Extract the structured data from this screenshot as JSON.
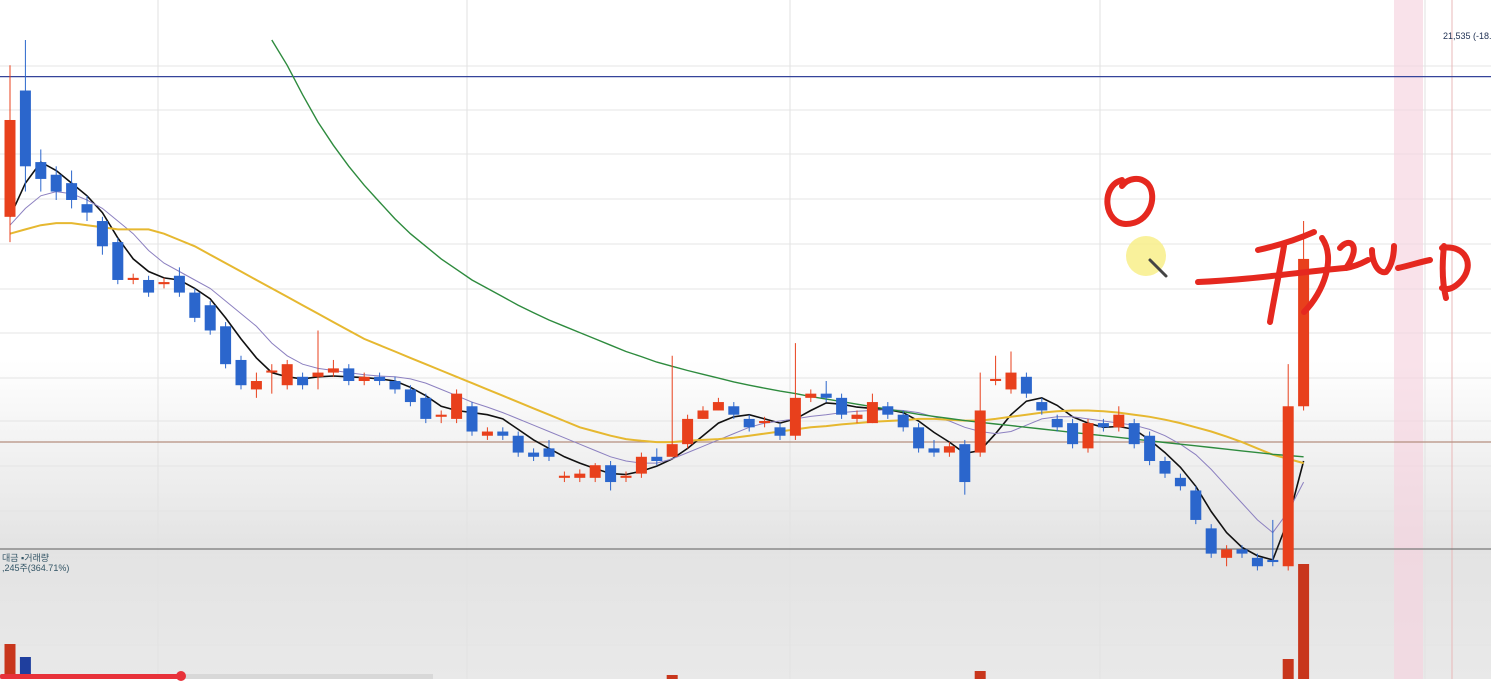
{
  "labels": {
    "price_reference": "21,535 (-18.",
    "volume_title": "대금 ▪거래량",
    "volume_readout": ",245주(364.71%)"
  },
  "colors": {
    "up": "#e8401c",
    "down": "#2b66cc",
    "ma5": "#111111",
    "ma10": "#8c80c0",
    "ma20": "#e6b830",
    "ma60": "#2e8b3e",
    "reference_line": "#35449a",
    "annotation": "#e5281f",
    "highlight": "#f6d2df",
    "cursor": "#f8ef8a"
  },
  "chart_data": {
    "type": "candlestick",
    "title": "",
    "price_range": [
      0,
      100
    ],
    "reference_level": 91.3,
    "horizontal_marker_level": 19.5,
    "candles": [
      {
        "o": 58,
        "c": 81,
        "h": 94,
        "l": 52,
        "dir": "up"
      },
      {
        "o": 88,
        "c": 70,
        "h": 100,
        "l": 64,
        "dir": "down"
      },
      {
        "o": 71,
        "c": 67,
        "h": 74,
        "l": 64,
        "dir": "down"
      },
      {
        "o": 68,
        "c": 64,
        "h": 70,
        "l": 62,
        "dir": "down"
      },
      {
        "o": 66,
        "c": 62,
        "h": 69,
        "l": 60,
        "dir": "down"
      },
      {
        "o": 61,
        "c": 59,
        "h": 63,
        "l": 57,
        "dir": "down"
      },
      {
        "o": 57,
        "c": 51,
        "h": 58,
        "l": 49,
        "dir": "down"
      },
      {
        "o": 52,
        "c": 43,
        "h": 53,
        "l": 42,
        "dir": "down"
      },
      {
        "o": 43,
        "c": 43.5,
        "h": 44.5,
        "l": 42,
        "dir": "up"
      },
      {
        "o": 43,
        "c": 40,
        "h": 44,
        "l": 39,
        "dir": "down"
      },
      {
        "o": 42,
        "c": 42.5,
        "h": 43.5,
        "l": 41,
        "dir": "up"
      },
      {
        "o": 44,
        "c": 40,
        "h": 46,
        "l": 39,
        "dir": "down"
      },
      {
        "o": 40,
        "c": 34,
        "h": 41,
        "l": 33,
        "dir": "down"
      },
      {
        "o": 37,
        "c": 31,
        "h": 38,
        "l": 30,
        "dir": "down"
      },
      {
        "o": 32,
        "c": 23,
        "h": 33,
        "l": 22,
        "dir": "down"
      },
      {
        "o": 24,
        "c": 18,
        "h": 25,
        "l": 17,
        "dir": "down"
      },
      {
        "o": 17,
        "c": 19,
        "h": 21,
        "l": 15,
        "dir": "up"
      },
      {
        "o": 21,
        "c": 21.5,
        "h": 23,
        "l": 16,
        "dir": "up"
      },
      {
        "o": 18,
        "c": 23,
        "h": 24,
        "l": 17,
        "dir": "up"
      },
      {
        "o": 20,
        "c": 18,
        "h": 21,
        "l": 17,
        "dir": "down"
      },
      {
        "o": 20,
        "c": 21,
        "h": 31,
        "l": 17,
        "dir": "up"
      },
      {
        "o": 21,
        "c": 22,
        "h": 24,
        "l": 20,
        "dir": "up"
      },
      {
        "o": 22,
        "c": 19,
        "h": 23,
        "l": 18,
        "dir": "down"
      },
      {
        "o": 19,
        "c": 20,
        "h": 21,
        "l": 18,
        "dir": "up"
      },
      {
        "o": 20,
        "c": 19,
        "h": 21,
        "l": 18,
        "dir": "down"
      },
      {
        "o": 19,
        "c": 17,
        "h": 20,
        "l": 16,
        "dir": "down"
      },
      {
        "o": 17,
        "c": 14,
        "h": 18,
        "l": 13,
        "dir": "down"
      },
      {
        "o": 15,
        "c": 10,
        "h": 16,
        "l": 9,
        "dir": "down"
      },
      {
        "o": 10.5,
        "c": 11,
        "h": 12,
        "l": 9,
        "dir": "up"
      },
      {
        "o": 10,
        "c": 16,
        "h": 17,
        "l": 9,
        "dir": "up"
      },
      {
        "o": 13,
        "c": 7,
        "h": 14,
        "l": 6,
        "dir": "down"
      },
      {
        "o": 6,
        "c": 7,
        "h": 8,
        "l": 5,
        "dir": "up"
      },
      {
        "o": 7,
        "c": 6,
        "h": 8,
        "l": 5,
        "dir": "down"
      },
      {
        "o": 6,
        "c": 2,
        "h": 7,
        "l": 1,
        "dir": "down"
      },
      {
        "o": 2,
        "c": 1,
        "h": 3,
        "l": 0,
        "dir": "down"
      },
      {
        "o": 1,
        "c": 3,
        "h": 5,
        "l": 0,
        "dir": "down"
      },
      {
        "o": -4,
        "c": -3.5,
        "h": -2.5,
        "l": -5,
        "dir": "up"
      },
      {
        "o": -4,
        "c": -3,
        "h": -2,
        "l": -5,
        "dir": "up"
      },
      {
        "o": -4,
        "c": -1,
        "h": -0.5,
        "l": -5,
        "dir": "up"
      },
      {
        "o": -1,
        "c": -5,
        "h": 0,
        "l": -7,
        "dir": "down"
      },
      {
        "o": -4,
        "c": -3.5,
        "h": -2.5,
        "l": -5,
        "dir": "up"
      },
      {
        "o": -3,
        "c": 1,
        "h": 2,
        "l": -4,
        "dir": "up"
      },
      {
        "o": 1,
        "c": 0,
        "h": 3,
        "l": -1,
        "dir": "down"
      },
      {
        "o": 1,
        "c": 4,
        "h": 25,
        "l": 1,
        "dir": "up"
      },
      {
        "o": 4,
        "c": 10,
        "h": 11,
        "l": 3,
        "dir": "up"
      },
      {
        "o": 10,
        "c": 12,
        "h": 13,
        "l": 10,
        "dir": "up"
      },
      {
        "o": 12,
        "c": 14,
        "h": 15,
        "l": 12,
        "dir": "up"
      },
      {
        "o": 13,
        "c": 11,
        "h": 14,
        "l": 10,
        "dir": "down"
      },
      {
        "o": 10,
        "c": 8,
        "h": 11,
        "l": 7,
        "dir": "down"
      },
      {
        "o": 9,
        "c": 9.5,
        "h": 10.5,
        "l": 8,
        "dir": "up"
      },
      {
        "o": 8,
        "c": 6,
        "h": 9,
        "l": 5,
        "dir": "down"
      },
      {
        "o": 6,
        "c": 15,
        "h": 28,
        "l": 5,
        "dir": "up"
      },
      {
        "o": 15,
        "c": 16,
        "h": 17,
        "l": 14,
        "dir": "up"
      },
      {
        "o": 16,
        "c": 15,
        "h": 19,
        "l": 14,
        "dir": "down"
      },
      {
        "o": 15,
        "c": 11,
        "h": 16,
        "l": 10,
        "dir": "down"
      },
      {
        "o": 10,
        "c": 11,
        "h": 12,
        "l": 9,
        "dir": "up"
      },
      {
        "o": 9,
        "c": 14,
        "h": 16,
        "l": 9,
        "dir": "up"
      },
      {
        "o": 13,
        "c": 11,
        "h": 14,
        "l": 10,
        "dir": "down"
      },
      {
        "o": 11,
        "c": 8,
        "h": 12,
        "l": 7,
        "dir": "down"
      },
      {
        "o": 8,
        "c": 3,
        "h": 9,
        "l": 2,
        "dir": "down"
      },
      {
        "o": 3,
        "c": 2,
        "h": 5,
        "l": 1,
        "dir": "down"
      },
      {
        "o": 2,
        "c": 3.5,
        "h": 4.5,
        "l": 1,
        "dir": "up"
      },
      {
        "o": 4,
        "c": -5,
        "h": 5,
        "l": -8,
        "dir": "down"
      },
      {
        "o": 2,
        "c": 12,
        "h": 21,
        "l": 1,
        "dir": "up"
      },
      {
        "o": 19,
        "c": 19.5,
        "h": 25,
        "l": 18,
        "dir": "up"
      },
      {
        "o": 17,
        "c": 21,
        "h": 26,
        "l": 16,
        "dir": "up"
      },
      {
        "o": 20,
        "c": 16,
        "h": 21,
        "l": 15,
        "dir": "down"
      },
      {
        "o": 14,
        "c": 12,
        "h": 15,
        "l": 11,
        "dir": "down"
      },
      {
        "o": 8,
        "c": 10,
        "h": 11,
        "l": 7,
        "dir": "down"
      },
      {
        "o": 9,
        "c": 4,
        "h": 10,
        "l": 3,
        "dir": "down"
      },
      {
        "o": 9,
        "c": 3,
        "h": 10,
        "l": 2,
        "dir": "up"
      },
      {
        "o": 9,
        "c": 8,
        "h": 10,
        "l": 7,
        "dir": "down"
      },
      {
        "o": 11,
        "c": 8,
        "h": 13,
        "l": 7,
        "dir": "up"
      },
      {
        "o": 9,
        "c": 4,
        "h": 10,
        "l": 3,
        "dir": "down"
      },
      {
        "o": 6,
        "c": 0,
        "h": 7,
        "l": -1,
        "dir": "down"
      },
      {
        "o": 0,
        "c": -3,
        "h": 1,
        "l": -4,
        "dir": "down"
      },
      {
        "o": -4,
        "c": -6,
        "h": -3,
        "l": -7,
        "dir": "down"
      },
      {
        "o": -7,
        "c": -14,
        "h": -6,
        "l": -15,
        "dir": "down"
      },
      {
        "o": -16,
        "c": -22,
        "h": -15,
        "l": -23,
        "dir": "down"
      },
      {
        "o": -23,
        "c": -21,
        "h": -20,
        "l": -25,
        "dir": "up"
      },
      {
        "o": -21,
        "c": -22,
        "h": -20,
        "l": -23,
        "dir": "down"
      },
      {
        "o": -23,
        "c": -25,
        "h": -22,
        "l": -26,
        "dir": "down"
      },
      {
        "o": -24,
        "c": -23.5,
        "h": -14,
        "l": -25,
        "dir": "down"
      },
      {
        "o": -25,
        "c": 13,
        "h": 23,
        "l": -26,
        "dir": "up"
      },
      {
        "o": 13,
        "c": 48,
        "h": 57,
        "l": 12,
        "dir": "up"
      }
    ],
    "moving_averages": [
      {
        "name": "ma5",
        "values": [
          58,
          66,
          71,
          69,
          66,
          63,
          59,
          53,
          48,
          45,
          43.5,
          43,
          41,
          38.5,
          34,
          29,
          24.5,
          21,
          20,
          19.5,
          20,
          20.2,
          20,
          19.8,
          19.5,
          19,
          17.5,
          15.5,
          13,
          12,
          11.5,
          11,
          10,
          7.5,
          5,
          3,
          1,
          -0.5,
          -1.8,
          -3,
          -3.2,
          -2.4,
          -1.2,
          0.5,
          3,
          6,
          9,
          10.5,
          11,
          10,
          9,
          10,
          12,
          13.8,
          13.5,
          12.8,
          12.5,
          12.2,
          11.5,
          9.5,
          6.8,
          4.5,
          1.8,
          2.5,
          6.5,
          11,
          14.2,
          15,
          13.2,
          10.5,
          9,
          8,
          8.2,
          7.5,
          5,
          2,
          -1.5,
          -6,
          -12,
          -17,
          -20.5,
          -22.5,
          -23.5,
          -14,
          0
        ]
      },
      {
        "name": "ma10",
        "values": [
          56,
          60,
          63,
          64,
          63.5,
          62,
          60,
          57,
          54,
          50,
          47,
          45,
          43,
          41,
          38,
          35,
          32,
          28,
          25,
          23,
          22,
          21.5,
          21,
          20.5,
          20.2,
          20,
          19.5,
          18.5,
          17,
          15.5,
          14,
          12.8,
          11.5,
          10,
          8.5,
          7,
          5.5,
          4,
          2.5,
          1,
          0,
          -0.5,
          -0.5,
          0.5,
          2,
          3.5,
          5,
          6.5,
          8,
          9,
          9.5,
          10,
          10.6,
          11,
          11.5,
          11.8,
          12,
          12.2,
          12,
          11.5,
          10.5,
          9.5,
          8,
          7,
          6.5,
          7,
          8.5,
          10,
          10.5,
          10.5,
          10,
          9.5,
          9,
          8.5,
          7.5,
          6,
          4,
          1.5,
          -2,
          -6,
          -10,
          -14,
          -17,
          -12,
          -5
        ]
      },
      {
        "name": "ma20",
        "values": [
          54,
          55,
          56,
          56.5,
          56.5,
          56,
          55.5,
          55,
          55,
          55,
          54,
          52.5,
          51,
          49,
          47,
          45,
          43,
          41,
          39,
          37,
          35,
          33,
          31,
          29,
          27.5,
          26,
          24.5,
          23,
          21.5,
          20,
          18.5,
          17,
          15.5,
          14,
          12.5,
          11,
          9.5,
          8,
          7,
          6,
          5.2,
          4.8,
          4.5,
          4.5,
          4.8,
          5,
          5.2,
          5.5,
          6,
          6.5,
          7,
          7.5,
          8,
          8.3,
          8.7,
          9,
          9.3,
          9.5,
          9.7,
          10,
          10,
          9.8,
          9.6,
          9.6,
          10,
          10.5,
          11,
          11.5,
          11.8,
          12,
          12,
          11.8,
          11.5,
          11,
          10.5,
          9.8,
          9,
          8,
          7,
          5.8,
          4.5,
          3,
          1.5,
          0.5,
          -0.5
        ]
      },
      {
        "name": "ma60",
        "values": [
          null,
          null,
          null,
          null,
          null,
          null,
          null,
          null,
          null,
          null,
          null,
          null,
          null,
          null,
          null,
          null,
          null,
          100,
          94,
          87,
          80.5,
          75,
          70,
          65.5,
          61.5,
          57.5,
          54,
          51,
          48,
          45.5,
          43,
          41,
          39,
          37,
          35.2,
          33.5,
          32,
          30.5,
          29,
          27.5,
          26,
          24.8,
          23.5,
          22.5,
          21.5,
          20.6,
          19.7,
          18.8,
          18,
          17.3,
          16.6,
          16,
          15.3,
          14.7,
          14.1,
          13.5,
          12.9,
          12.3,
          11.7,
          11.1,
          10.6,
          10.1,
          9.6,
          9.2,
          8.8,
          8.4,
          8,
          7.6,
          7.2,
          6.8,
          6.4,
          6,
          5.6,
          5.2,
          4.8,
          4.4,
          4,
          3.6,
          3.2,
          2.8,
          2.4,
          2,
          1.6,
          1.3,
          1
        ]
      }
    ],
    "volume": [
      {
        "v": 35,
        "dir": "up"
      },
      {
        "v": 22,
        "dir": "down"
      },
      {
        "v": 0,
        "dir": "down"
      },
      {
        "v": 0,
        "dir": "down"
      },
      {
        "v": 0,
        "dir": "down"
      },
      {
        "v": 0,
        "dir": "down"
      },
      {
        "v": 0,
        "dir": "down"
      },
      {
        "v": 0,
        "dir": "down"
      },
      {
        "v": 0,
        "dir": "up"
      },
      {
        "v": 0,
        "dir": "down"
      },
      {
        "v": 0,
        "dir": "up"
      },
      {
        "v": 0,
        "dir": "down"
      },
      {
        "v": 0,
        "dir": "down"
      },
      {
        "v": 0,
        "dir": "down"
      },
      {
        "v": 0,
        "dir": "down"
      },
      {
        "v": 0,
        "dir": "down"
      },
      {
        "v": 0,
        "dir": "up"
      },
      {
        "v": 0,
        "dir": "up"
      },
      {
        "v": 0,
        "dir": "up"
      },
      {
        "v": 0,
        "dir": "down"
      },
      {
        "v": 0,
        "dir": "up"
      },
      {
        "v": 0,
        "dir": "up"
      },
      {
        "v": 0,
        "dir": "down"
      },
      {
        "v": 0,
        "dir": "up"
      },
      {
        "v": 0,
        "dir": "down"
      },
      {
        "v": 0,
        "dir": "down"
      },
      {
        "v": 0,
        "dir": "down"
      },
      {
        "v": 0,
        "dir": "down"
      },
      {
        "v": 0,
        "dir": "up"
      },
      {
        "v": 0,
        "dir": "up"
      },
      {
        "v": 0,
        "dir": "down"
      },
      {
        "v": 0,
        "dir": "up"
      },
      {
        "v": 0,
        "dir": "down"
      },
      {
        "v": 0,
        "dir": "down"
      },
      {
        "v": 0,
        "dir": "down"
      },
      {
        "v": 0,
        "dir": "down"
      },
      {
        "v": 0,
        "dir": "up"
      },
      {
        "v": 0,
        "dir": "up"
      },
      {
        "v": 0,
        "dir": "up"
      },
      {
        "v": 0,
        "dir": "down"
      },
      {
        "v": 0,
        "dir": "up"
      },
      {
        "v": 0,
        "dir": "up"
      },
      {
        "v": 0,
        "dir": "down"
      },
      {
        "v": 4,
        "dir": "up"
      },
      {
        "v": 0,
        "dir": "up"
      },
      {
        "v": 0,
        "dir": "up"
      },
      {
        "v": 0,
        "dir": "up"
      },
      {
        "v": 0,
        "dir": "down"
      },
      {
        "v": 0,
        "dir": "down"
      },
      {
        "v": 0,
        "dir": "up"
      },
      {
        "v": 0,
        "dir": "down"
      },
      {
        "v": 0,
        "dir": "up"
      },
      {
        "v": 0,
        "dir": "up"
      },
      {
        "v": 0,
        "dir": "down"
      },
      {
        "v": 0,
        "dir": "down"
      },
      {
        "v": 0,
        "dir": "up"
      },
      {
        "v": 0,
        "dir": "up"
      },
      {
        "v": 0,
        "dir": "down"
      },
      {
        "v": 0,
        "dir": "down"
      },
      {
        "v": 0,
        "dir": "down"
      },
      {
        "v": 0,
        "dir": "down"
      },
      {
        "v": 0,
        "dir": "up"
      },
      {
        "v": 0,
        "dir": "down"
      },
      {
        "v": 8,
        "dir": "up"
      },
      {
        "v": 0,
        "dir": "up"
      },
      {
        "v": 0,
        "dir": "up"
      },
      {
        "v": 0,
        "dir": "down"
      },
      {
        "v": 0,
        "dir": "down"
      },
      {
        "v": 0,
        "dir": "down"
      },
      {
        "v": 0,
        "dir": "down"
      },
      {
        "v": 0,
        "dir": "up"
      },
      {
        "v": 0,
        "dir": "down"
      },
      {
        "v": 0,
        "dir": "up"
      },
      {
        "v": 0,
        "dir": "down"
      },
      {
        "v": 0,
        "dir": "down"
      },
      {
        "v": 0,
        "dir": "down"
      },
      {
        "v": 0,
        "dir": "down"
      },
      {
        "v": 0,
        "dir": "down"
      },
      {
        "v": 0,
        "dir": "down"
      },
      {
        "v": 0,
        "dir": "up"
      },
      {
        "v": 0,
        "dir": "down"
      },
      {
        "v": 0,
        "dir": "down"
      },
      {
        "v": 0,
        "dir": "down"
      },
      {
        "v": 20,
        "dir": "up"
      },
      {
        "v": 115,
        "dir": "up"
      }
    ]
  }
}
